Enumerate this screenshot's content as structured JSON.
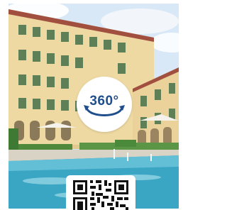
{
  "badge": {
    "label": "360°",
    "icon": "360-rotate-icon",
    "color": "#1f4e8c"
  },
  "photo": {
    "icon": "hotel-courtyard-photo"
  },
  "qr": {
    "icon": "qr-code-icon"
  }
}
